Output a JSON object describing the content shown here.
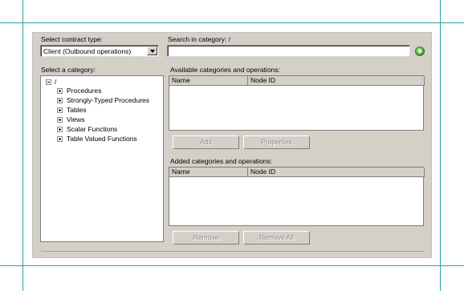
{
  "contract_type": {
    "label": "Select contract type:",
    "value": "Client (Outbound operations)"
  },
  "search": {
    "label": "Search in category: /",
    "value": ""
  },
  "category": {
    "label": "Select a category:",
    "root": "/",
    "items": [
      {
        "label": "Procedures"
      },
      {
        "label": "Strongly-Typed Procedures"
      },
      {
        "label": "Tables"
      },
      {
        "label": "Views"
      },
      {
        "label": "Scalar Functions"
      },
      {
        "label": "Table Valued Functions"
      }
    ]
  },
  "available": {
    "label": "Available categories and operations:",
    "columns": [
      "Name",
      "Node ID"
    ]
  },
  "added": {
    "label": "Added categories and operations:",
    "columns": [
      "Name",
      "Node ID"
    ]
  },
  "buttons": {
    "add": "Add",
    "properties": "Properties",
    "remove": "Remove",
    "remove_all": "Remove All"
  },
  "colors": {
    "guide_lines": "#2aa0a0",
    "dialog_bg": "#d4d0c8"
  }
}
